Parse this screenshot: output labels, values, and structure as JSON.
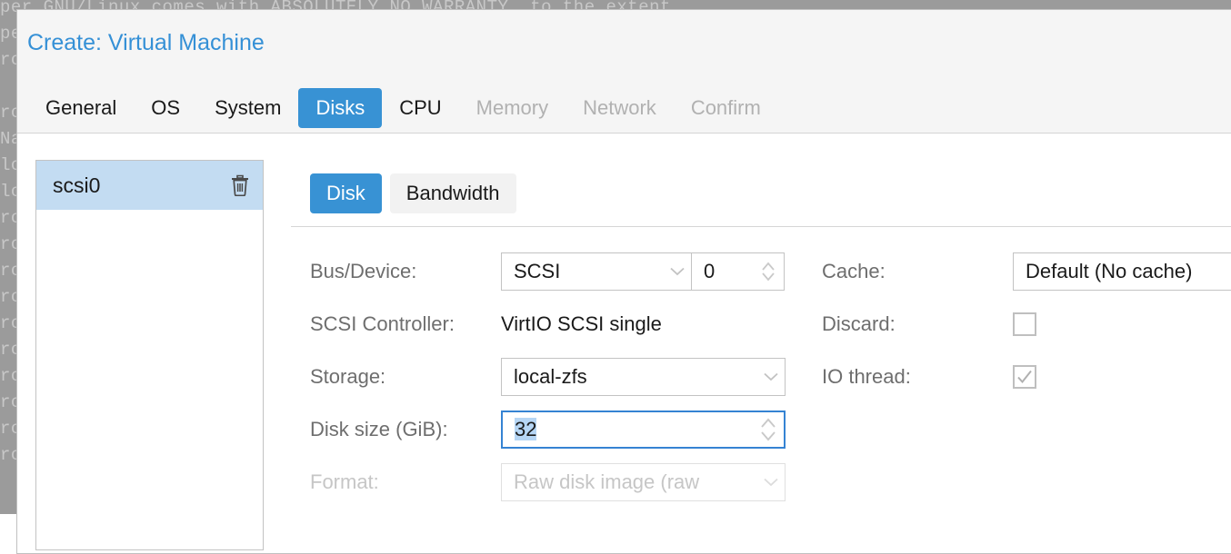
{
  "backdrop": {
    "text": "per GNU/Linux comes with ABSOLUTELY NO WARRANTY, to the extent\npermitted by applicable law.\nroot@pve:~# qm list\n      VMID NAME                 STATUS     MEM(MB)    BOOTDISK(GB) PID\nroot@pve:~# pvesm status\nName             Type     Status           Total            Used       Available\nlocal             dir     active        98559220         2843648        90668052\nlocal-zfs     zfspool     active       899678208          104448       899573760\nroot@pve:~# journalctl -u pveproxy -n 20\nroot@pve:~# systemctl status pvedaemon\nroot@pve:~# cat /etc/pve/storage.cfg\nroot@pve:~# ls -lah /var/lib/vz/template/iso\nroot@pve:~# pveversion -v | head -5\nroot@pve:~# df -h /\nroot@pve:~# zpool status rpool\nroot@pve:~# zfs list\nroot@pve:~# ip -brief addr show\nroot@pve:~#"
  },
  "dialog": {
    "title": "Create: Virtual Machine",
    "wizard_tabs": [
      {
        "label": "General",
        "state": "normal"
      },
      {
        "label": "OS",
        "state": "normal"
      },
      {
        "label": "System",
        "state": "normal"
      },
      {
        "label": "Disks",
        "state": "active"
      },
      {
        "label": "CPU",
        "state": "normal"
      },
      {
        "label": "Memory",
        "state": "disabled"
      },
      {
        "label": "Network",
        "state": "disabled"
      },
      {
        "label": "Confirm",
        "state": "disabled"
      }
    ]
  },
  "device_list": {
    "items": [
      {
        "label": "scsi0",
        "selected": true,
        "delete_icon": "trash-icon"
      }
    ]
  },
  "sub_tabs": [
    {
      "label": "Disk",
      "state": "active"
    },
    {
      "label": "Bandwidth",
      "state": "normal"
    }
  ],
  "form": {
    "bus_device": {
      "label": "Bus/Device:",
      "bus_value": "SCSI",
      "device_value": "0",
      "chevron_icon": "chevron-down-icon",
      "spinner_icon": "spinner-updown-icon"
    },
    "scsi_controller": {
      "label": "SCSI Controller:",
      "value": "VirtIO SCSI single"
    },
    "storage": {
      "label": "Storage:",
      "value": "local-zfs",
      "chevron_icon": "chevron-down-icon"
    },
    "disk_size": {
      "label": "Disk size (GiB):",
      "value": "32",
      "focused": true,
      "text_selected": true,
      "spinner_icon": "spinner-updown-icon"
    },
    "format": {
      "label": "Format:",
      "value": "Raw disk image (raw",
      "disabled": true,
      "chevron_icon": "chevron-down-icon"
    },
    "cache": {
      "label": "Cache:",
      "value": "Default (No cache)",
      "chevron_icon": "chevron-down-icon"
    },
    "discard": {
      "label": "Discard:",
      "checked": false
    },
    "io_thread": {
      "label": "IO thread:",
      "checked": true
    }
  },
  "colors": {
    "accent_blue": "#3892d4",
    "title_blue": "#3590d6",
    "selection_blue": "#c3dcf2",
    "focus_border": "#3583d3",
    "text_selection": "#b6d6f5",
    "label_grey": "#6e6e6e",
    "disabled_grey": "#c6c6c6",
    "header_bg": "#f5f5f5",
    "backdrop": "#9b9b9b"
  }
}
